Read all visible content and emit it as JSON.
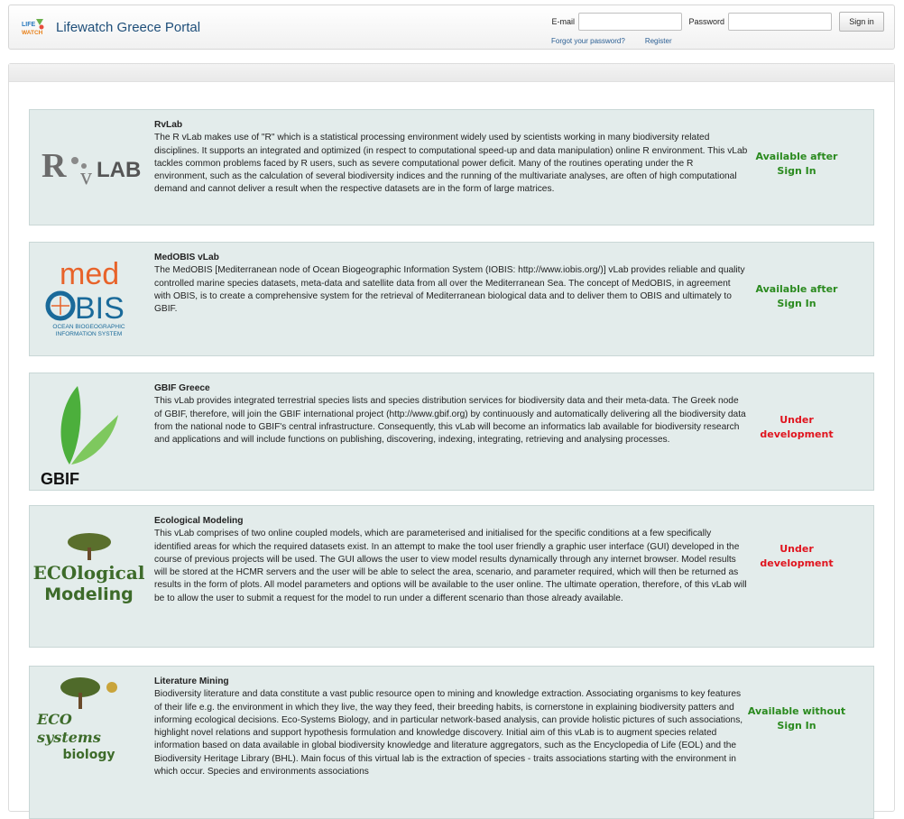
{
  "header": {
    "logo_text": "LIFE WATCH",
    "title": "Lifewatch Greece Portal",
    "email_label": "E-mail",
    "email_value": "",
    "password_label": "Password",
    "password_value": "",
    "signin_label": "Sign in",
    "forgot_link": "Forgot your password?",
    "register_link": "Register"
  },
  "labs": [
    {
      "logo": "RvLAB",
      "title": "RvLab",
      "description": "The R vLab makes use of \"R\" which is a statistical processing environment widely used by scientists working in many biodiversity related disciplines. It supports an integrated and optimized (in respect to computational speed-up and data manipulation) online R environment. This vLab tackles common problems faced by R users, such as severe computational power deficit. Many of the routines operating under the R environment, such as the calculation of several biodiversity indices and the running of the multivariate analyses, are often of high computational demand and cannot deliver a result when the respective datasets are in the form of large matrices.",
      "status": "Available after Sign In",
      "status_color": "#2a8a1e"
    },
    {
      "logo_line1": "med",
      "logo_line2": "OBIS",
      "logo_line3": "OCEAN BIOGEOGRAPHIC",
      "logo_line4": "INFORMATION SYSTEM",
      "title": "MedOBIS vLab",
      "description": "The MedOBIS [Mediterranean node of Ocean Biogeographic Information System (IOBIS: http://www.iobis.org/)] vLab provides reliable and quality controlled marine species datasets, meta-data and satellite data from all over the Mediterranean Sea. The concept of MedOBIS, in agreement with OBIS, is to create a comprehensive system for the retrieval of Mediterranean biological data and to deliver them to OBIS and ultimately to GBIF.",
      "status": "Available after Sign In",
      "status_color": "#2a8a1e"
    },
    {
      "logo": "GBIF",
      "title": "GBIF Greece",
      "description": "This vLab provides integrated terrestrial species lists and species distribution services for biodiversity data and their meta-data. The Greek node of GBIF, therefore, will join the GBIF international project (http://www.gbif.org) by continuously and automatically delivering all the biodiversity data from the national node to GBIF's central infrastructure. Consequently, this vLab will become an informatics lab available for biodiversity research and applications and will include functions on publishing, discovering, indexing, integrating, retrieving and analysing processes.",
      "status": "Under development",
      "status_color": "#e0141e"
    },
    {
      "logo_line1": "ECOlogical",
      "logo_line2": "Modeling",
      "title": "Ecological Modeling",
      "description": "This vLab comprises of two online coupled models, which are parameterised and initialised for the specific conditions at a few specifically identified areas for which the required datasets exist. In an attempt to make the tool user friendly a graphic user interface (GUI) developed in the course of previous projects will be used. The GUI allows the user to view model results dynamically through any internet browser. Model results will be stored at the HCMR servers and the user will be able to select the area, scenario, and parameter required, which will then be returned as results in the form of plots. All model parameters and options will be available to the user online. The ultimate operation, therefore, of this vLab will be to allow the user to submit a request for the model to run under a different scenario than those already available.",
      "status": "Under development",
      "status_color": "#e0141e"
    },
    {
      "logo_line1": "ECO systems",
      "logo_line2": "biology",
      "title": "Literature Mining",
      "description": "Biodiversity literature and data constitute a vast public resource open to mining and knowledge extraction. Associating organisms to key features of their life e.g. the environment in which they live, the way they feed, their breeding habits, is cornerstone in explaining biodiversity patters and informing ecological decisions. Eco-Systems Biology, and in particular network-based analysis, can provide holistic pictures of such associations, highlight novel relations and support hypothesis formulation and knowledge discovery. Initial aim of this vLab is to augment species related information based on data available in global biodiversity knowledge and literature aggregators, such as the Encyclopedia of Life (EOL) and the Biodiversity Heritage Library (BHL). Main focus of this virtual lab is the extraction of species - traits associations starting with the environment in which occur. Species and environments associations",
      "status": "Available without Sign In",
      "status_color": "#2a8a1e"
    }
  ]
}
